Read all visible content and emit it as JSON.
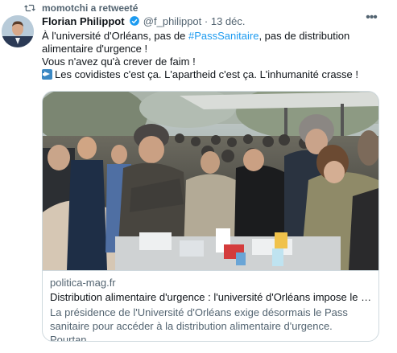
{
  "retweet": {
    "label": "momotchi a retweeté",
    "icon": "retweet-icon"
  },
  "tweet": {
    "author_name": "Florian Philippot",
    "handle": "@f_philippot",
    "separator": "·",
    "date": "13 déc.",
    "line1_prefix": "À l'université d'Orléans, pas de ",
    "hashtag": "#PassSanitaire",
    "line1_suffix": ", pas de distribution alimentaire d'urgence !",
    "line2": "Vous n'avez qu'à crever de faim !",
    "line3": "Les covidistes c'est ça. L'apartheid c'est ça. L'inhumanité crasse !",
    "verified_color": "#1d9bf0"
  },
  "card": {
    "domain": "politica-mag.fr",
    "title": "Distribution alimentaire d'urgence : l'université d'Orléans impose le p...",
    "description": "La présidence de l'Université d'Orléans exige désormais le Pass sanitaire pour accéder à la distribution alimentaire d'urgence. Pourtan..."
  }
}
